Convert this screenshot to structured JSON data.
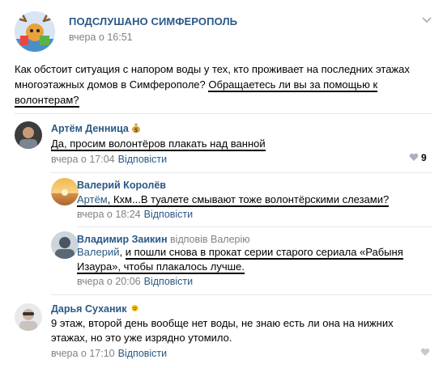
{
  "post": {
    "group_name": "ПОДСЛУШАНО СИМФЕРОПОЛЬ",
    "time": "вчера о 16:51",
    "text_line1": "Как обстоит ситуация с напором воды у тех, кто проживает на последних этажах",
    "text_line2_plain": "многоэтажных домов в Симферополе? ",
    "text_line2_underlined": "Обращаетесь ли вы за помощью к",
    "text_line3_underlined": "волонтерам?"
  },
  "comments": [
    {
      "author": "Артём Денница",
      "badge_icon": "money-bag-icon",
      "text": "Да, просим волонтёров плакать над ванной",
      "time": "вчера о 17:04",
      "reply_label": "Відповісти",
      "likes": "9"
    },
    {
      "author": "Валерий Королёв",
      "mention": "Артём",
      "text": ", Кхм...В туалете смывают тоже волонтёрскими слезами?",
      "time": "вчера о 18:24",
      "reply_label": "Відповісти"
    },
    {
      "author": "Владимир Заикин",
      "author_extra": "відповів Валерію",
      "mention": "Валерий",
      "text_a": ", ",
      "text_b": "и пошли снова в прокат серии старого сериала «Рабыня",
      "text_c": "Изаура», чтобы плакалось лучше.",
      "time": "вчера о 20:06",
      "reply_label": "Відповісти"
    },
    {
      "author": "Дарья Суханик",
      "badge_icon": "sun-icon",
      "text_line1": "9 этаж, второй день вообще нет воды, не знаю есть ли она на нижних",
      "text_line2": "этажах, но это уже изрядно утомило.",
      "time": "вчера о 17:10",
      "reply_label": "Відповісти"
    }
  ],
  "colors": {
    "link": "#2a5885",
    "muted": "#828282"
  }
}
